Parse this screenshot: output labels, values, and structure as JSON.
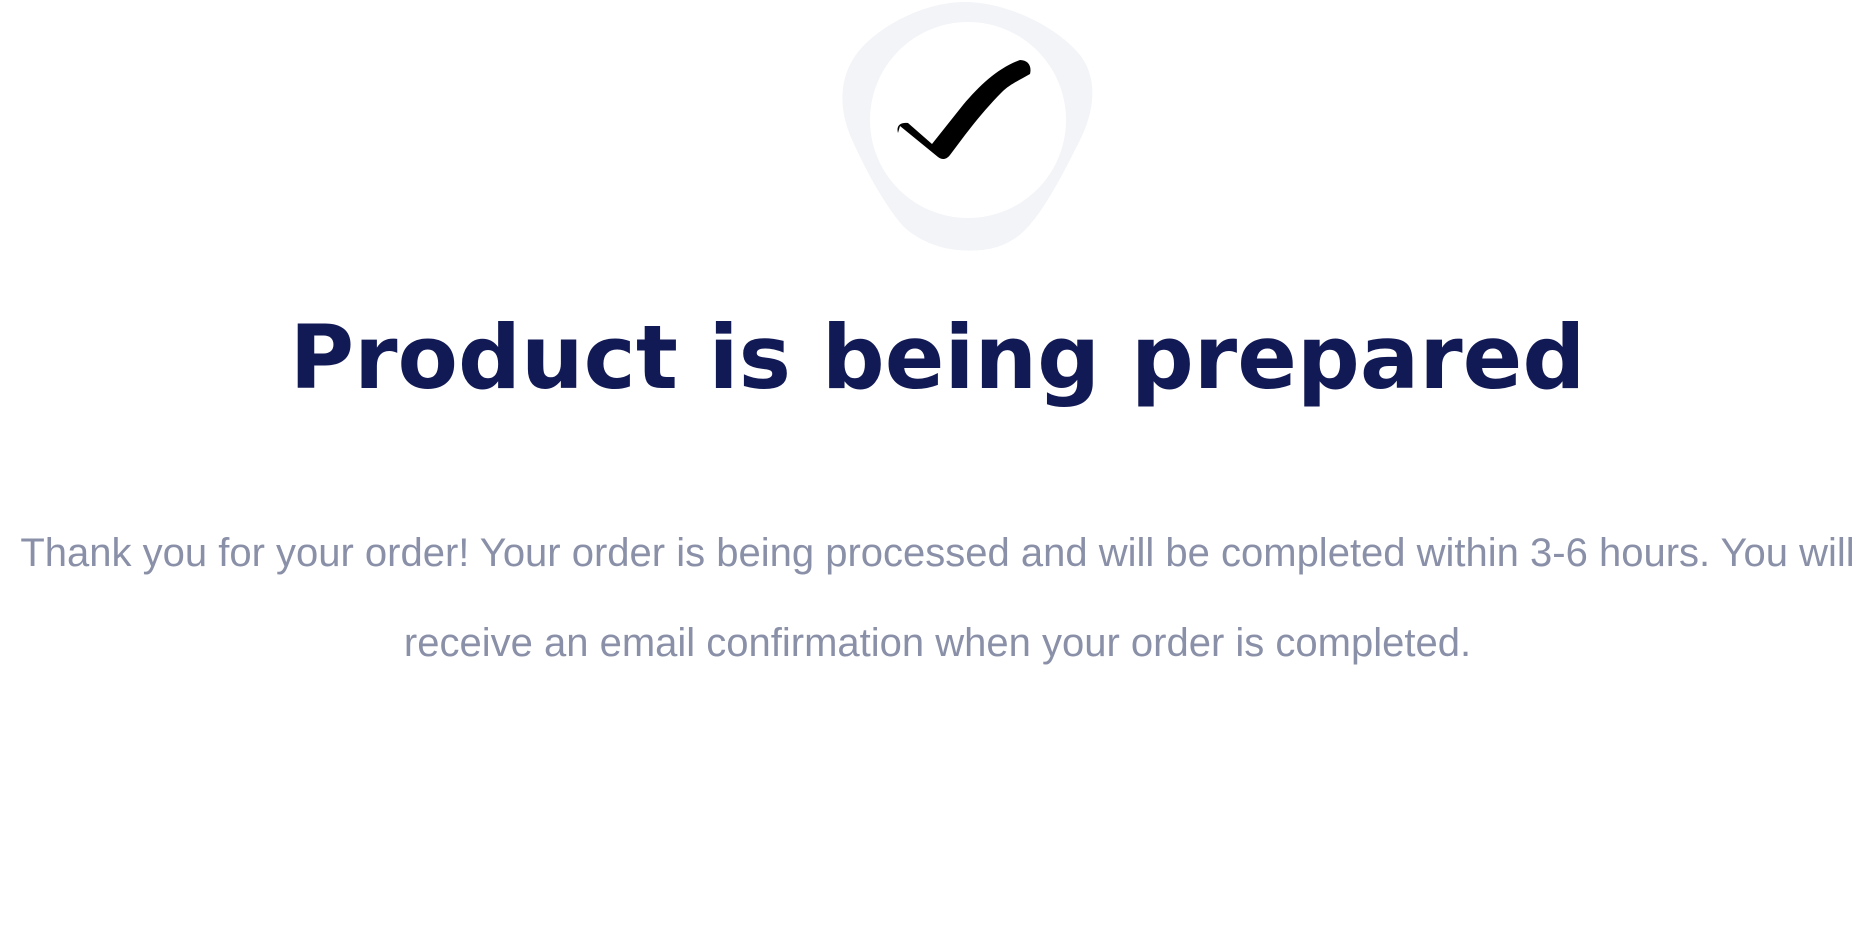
{
  "icon": {
    "name": "checkmark-icon"
  },
  "confirmation": {
    "title": "Product is being prepared",
    "message": "Thank you for your order! Your order is being processed and will be completed within 3-6 hours. You will receive an email confirmation when your order is completed."
  },
  "colors": {
    "title": "#121a55",
    "message": "#8a90a8",
    "icon_ring": "#f3f4f8",
    "check": "#000000"
  }
}
